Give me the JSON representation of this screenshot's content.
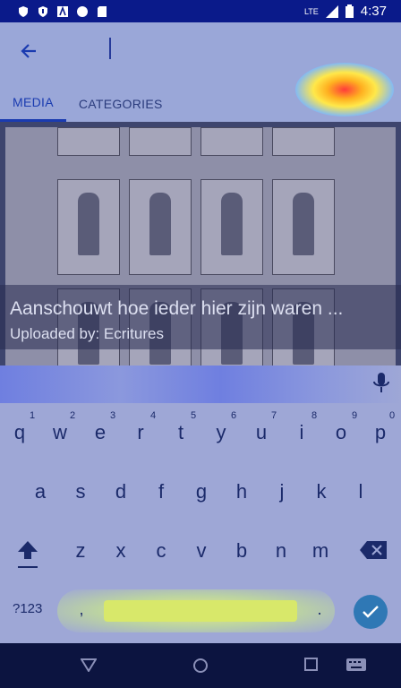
{
  "status_bar": {
    "time": "4:37",
    "network_label": "LTE",
    "left_icons": [
      "shield-icon",
      "shield-alt-icon",
      "text-icon",
      "circle-icon",
      "sd-card-icon"
    ]
  },
  "search": {
    "placeholder": "",
    "value": ""
  },
  "tabs": [
    {
      "label": "MEDIA",
      "active": true
    },
    {
      "label": "CATEGORIES",
      "active": false
    }
  ],
  "media": {
    "title": "Aanschouwt hoe ieder hier zijn waren ...",
    "uploader": "Uploaded by: Ecritures"
  },
  "keyboard": {
    "row1": [
      "q",
      "w",
      "e",
      "r",
      "t",
      "y",
      "u",
      "i",
      "o",
      "p"
    ],
    "row1_numbers": [
      "1",
      "2",
      "3",
      "4",
      "5",
      "6",
      "7",
      "8",
      "9",
      "0"
    ],
    "row2": [
      "a",
      "s",
      "d",
      "f",
      "g",
      "h",
      "j",
      "k",
      "l"
    ],
    "row3": [
      "z",
      "x",
      "c",
      "v",
      "b",
      "n",
      "m"
    ],
    "symbols_label": "?123",
    "comma": ",",
    "period": "."
  },
  "colors": {
    "accent": "#1a3bb0",
    "keyboard_bg": "#9ea7d6",
    "done": "#2f78b5"
  }
}
